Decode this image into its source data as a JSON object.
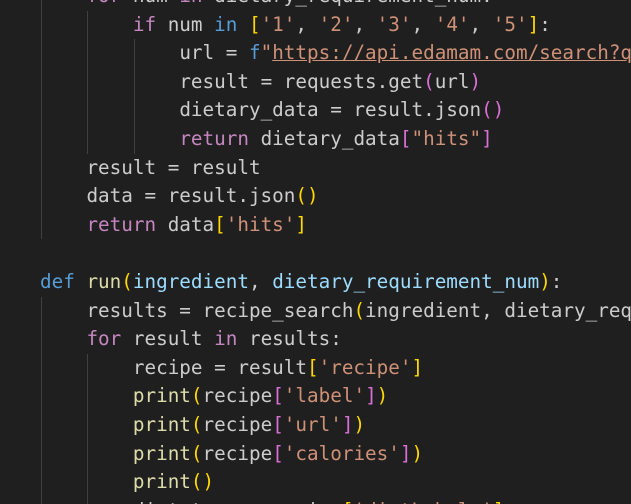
{
  "editor": {
    "language": "python",
    "theme_colors": {
      "background": "#1f1f1f",
      "keyword": "#569cd6",
      "control": "#c586c0",
      "function": "#dcdcaa",
      "variable": "#9cdcfe",
      "string": "#ce9178",
      "plain": "#cccccc"
    },
    "lines": [
      [
        {
          "t": "    "
        },
        {
          "t": "for",
          "c": "ctl"
        },
        {
          "t": " num "
        },
        {
          "t": "in",
          "c": "ctl"
        },
        {
          "t": " dietary_requirement_num:"
        }
      ],
      [
        {
          "t": "        "
        },
        {
          "t": "if",
          "c": "ctl"
        },
        {
          "t": " num "
        },
        {
          "t": "in",
          "c": "kw"
        },
        {
          "t": " "
        },
        {
          "t": "[",
          "c": "p1"
        },
        {
          "t": "'1'",
          "c": "str"
        },
        {
          "t": ", "
        },
        {
          "t": "'2'",
          "c": "str"
        },
        {
          "t": ", "
        },
        {
          "t": "'3'",
          "c": "str"
        },
        {
          "t": ", "
        },
        {
          "t": "'4'",
          "c": "str"
        },
        {
          "t": ", "
        },
        {
          "t": "'5'",
          "c": "str"
        },
        {
          "t": "]",
          "c": "p1"
        },
        {
          "t": ":"
        }
      ],
      [
        {
          "t": "            "
        },
        {
          "t": "url",
          "c": "plain"
        },
        {
          "t": " = "
        },
        {
          "t": "f",
          "c": "kw"
        },
        {
          "t": "\"",
          "c": "str"
        },
        {
          "t": "https://api.edamam.com/search?q=",
          "c": "url"
        }
      ],
      [
        {
          "t": "            "
        },
        {
          "t": "result = requests.get"
        },
        {
          "t": "(",
          "c": "p2"
        },
        {
          "t": "url"
        },
        {
          "t": ")",
          "c": "p2"
        }
      ],
      [
        {
          "t": "            "
        },
        {
          "t": "dietary_data = result.json"
        },
        {
          "t": "()",
          "c": "p2"
        }
      ],
      [
        {
          "t": "            "
        },
        {
          "t": "return",
          "c": "ctl"
        },
        {
          "t": " dietary_data"
        },
        {
          "t": "[",
          "c": "p2"
        },
        {
          "t": "\"hits\"",
          "c": "str"
        },
        {
          "t": "]",
          "c": "p2"
        }
      ],
      [
        {
          "t": "    "
        },
        {
          "t": "result = result"
        }
      ],
      [
        {
          "t": "    "
        },
        {
          "t": "data = result.json"
        },
        {
          "t": "()",
          "c": "p1"
        }
      ],
      [
        {
          "t": "    "
        },
        {
          "t": "return",
          "c": "ctl"
        },
        {
          "t": " data"
        },
        {
          "t": "[",
          "c": "p1"
        },
        {
          "t": "'hits'",
          "c": "str"
        },
        {
          "t": "]",
          "c": "p1"
        }
      ],
      [
        {
          "t": ""
        }
      ],
      [
        {
          "t": "def",
          "c": "kw"
        },
        {
          "t": " "
        },
        {
          "t": "run",
          "c": "fn"
        },
        {
          "t": "(",
          "c": "p1"
        },
        {
          "t": "ingredient",
          "c": "var"
        },
        {
          "t": ", "
        },
        {
          "t": "dietary_requirement_num",
          "c": "var"
        },
        {
          "t": ")",
          "c": "p1"
        },
        {
          "t": ":"
        }
      ],
      [
        {
          "t": "    "
        },
        {
          "t": "results = recipe_search"
        },
        {
          "t": "(",
          "c": "p1"
        },
        {
          "t": "ingredient, dietary_requ"
        }
      ],
      [
        {
          "t": "    "
        },
        {
          "t": "for",
          "c": "ctl"
        },
        {
          "t": " result "
        },
        {
          "t": "in",
          "c": "ctl"
        },
        {
          "t": " results:"
        }
      ],
      [
        {
          "t": "        "
        },
        {
          "t": "recipe = result"
        },
        {
          "t": "[",
          "c": "p1"
        },
        {
          "t": "'recipe'",
          "c": "str"
        },
        {
          "t": "]",
          "c": "p1"
        }
      ],
      [
        {
          "t": "        "
        },
        {
          "t": "print",
          "c": "fn"
        },
        {
          "t": "(",
          "c": "p1"
        },
        {
          "t": "recipe"
        },
        {
          "t": "[",
          "c": "p2"
        },
        {
          "t": "'label'",
          "c": "str"
        },
        {
          "t": "]",
          "c": "p2"
        },
        {
          "t": ")",
          "c": "p1"
        }
      ],
      [
        {
          "t": "        "
        },
        {
          "t": "print",
          "c": "fn"
        },
        {
          "t": "(",
          "c": "p1"
        },
        {
          "t": "recipe"
        },
        {
          "t": "[",
          "c": "p2"
        },
        {
          "t": "'url'",
          "c": "str"
        },
        {
          "t": "]",
          "c": "p2"
        },
        {
          "t": ")",
          "c": "p1"
        }
      ],
      [
        {
          "t": "        "
        },
        {
          "t": "print",
          "c": "fn"
        },
        {
          "t": "(",
          "c": "p1"
        },
        {
          "t": "recipe"
        },
        {
          "t": "[",
          "c": "p2"
        },
        {
          "t": "'calories'",
          "c": "str"
        },
        {
          "t": "]",
          "c": "p2"
        },
        {
          "t": ")",
          "c": "p1"
        }
      ],
      [
        {
          "t": "        "
        },
        {
          "t": "print",
          "c": "fn"
        },
        {
          "t": "()",
          "c": "p1"
        }
      ],
      [
        {
          "t": "        "
        },
        {
          "t": "diet_type",
          "c": "plain"
        },
        {
          "t": " = recipe"
        },
        {
          "t": "[",
          "c": "p1"
        },
        {
          "t": "'dietLabels'",
          "c": "str"
        },
        {
          "t": "]",
          "c": "p1"
        }
      ]
    ]
  }
}
